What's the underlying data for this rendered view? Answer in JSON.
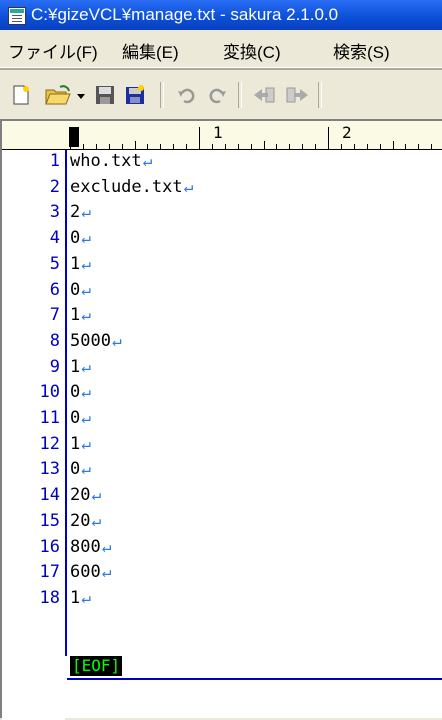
{
  "window": {
    "title": "C:¥gizeVCL¥manage.txt - sakura 2.1.0.0"
  },
  "menu": {
    "items": [
      "ファイル(F)",
      "編集(E)",
      "変換(C)",
      "検索(S)"
    ]
  },
  "toolbar": {
    "icons": [
      "new-file-icon",
      "open-folder-icon",
      "dropdown-arrow-icon",
      "save-icon",
      "save-all-icon",
      "undo-icon",
      "redo-icon",
      "jump-back-icon",
      "jump-forward-icon"
    ]
  },
  "ruler": {
    "marks": [
      "1",
      "2"
    ]
  },
  "editor": {
    "lines": [
      {
        "n": "1",
        "t": "who.txt"
      },
      {
        "n": "2",
        "t": "exclude.txt"
      },
      {
        "n": "3",
        "t": "2"
      },
      {
        "n": "4",
        "t": "0"
      },
      {
        "n": "5",
        "t": "1"
      },
      {
        "n": "6",
        "t": "0"
      },
      {
        "n": "7",
        "t": "1"
      },
      {
        "n": "8",
        "t": "5000"
      },
      {
        "n": "9",
        "t": "1"
      },
      {
        "n": "10",
        "t": "0"
      },
      {
        "n": "11",
        "t": "0"
      },
      {
        "n": "12",
        "t": "1"
      },
      {
        "n": "13",
        "t": "0"
      },
      {
        "n": "14",
        "t": "20"
      },
      {
        "n": "15",
        "t": "20"
      },
      {
        "n": "16",
        "t": "800"
      },
      {
        "n": "17",
        "t": "600"
      },
      {
        "n": "18",
        "t": "1"
      }
    ],
    "newline_mark": "↵",
    "eof_label": "[EOF]"
  }
}
